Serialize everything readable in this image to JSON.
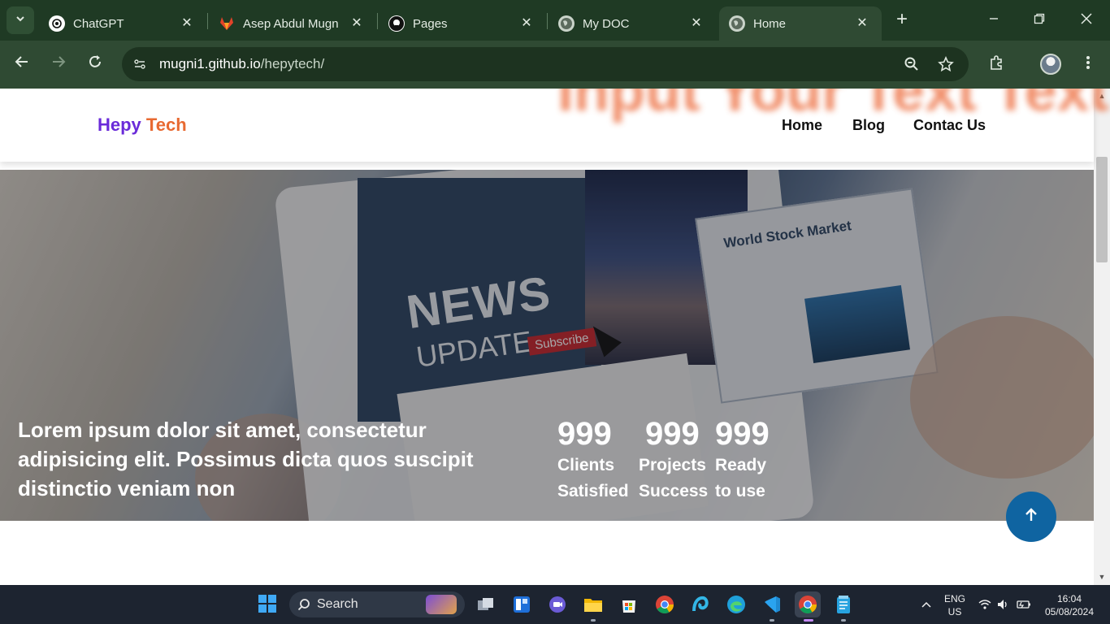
{
  "browser": {
    "tabs": [
      {
        "title": "ChatGPT",
        "icon": "chatgpt-icon",
        "active": false
      },
      {
        "title": "Asep Abdul Mugn",
        "icon": "gitlab-icon",
        "active": false
      },
      {
        "title": "Pages",
        "icon": "github-icon",
        "active": false
      },
      {
        "title": "My DOC",
        "icon": "globe-icon",
        "active": false
      },
      {
        "title": "Home",
        "icon": "globe-icon",
        "active": true
      }
    ],
    "url_domain": "mugni1.github.io",
    "url_path": "/hepytech/"
  },
  "site": {
    "logo_part1": "Hepy",
    "logo_part2": "Tech",
    "blurred_banner_text": "Input Your Text Text",
    "nav": [
      "Home",
      "Blog",
      "Contac Us"
    ],
    "hero_text": "Lorem ipsum dolor sit amet, consectetur adipisicing elit. Possimus dicta quos suscipit distinctio veniam non",
    "hero_image_text": {
      "news": "NEWS",
      "update": "UPDATE",
      "subscribe": "Subscribe",
      "stock_title": "World Stock Market"
    },
    "stats": [
      {
        "number": "999",
        "label_line1": "Clients",
        "label_line2": "Satisfied"
      },
      {
        "number": "999",
        "label_line1": "Projects",
        "label_line2": "Success"
      },
      {
        "number": "999",
        "label_line1": "Ready",
        "label_line2": "to use"
      }
    ]
  },
  "taskbar": {
    "search_label": "Search",
    "language_line1": "ENG",
    "language_line2": "US",
    "time": "16:04",
    "date": "05/08/2024"
  },
  "colors": {
    "logo_purple": "#6a2bd9",
    "logo_orange": "#e86a32",
    "scroll_button": "#0f64a1",
    "browser_frame": "#1f3a24"
  }
}
